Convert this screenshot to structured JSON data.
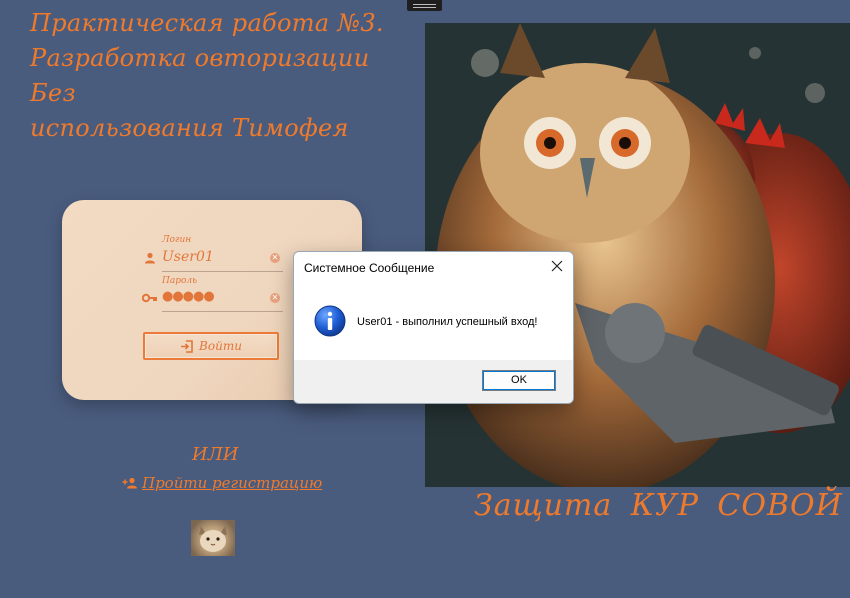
{
  "page": {
    "title_lines": [
      "Практическая работа №3.",
      "Разработка овторизации Без",
      "использования Тимофея"
    ],
    "accent_color": "#f07a2c",
    "background_color": "#4a5c7e"
  },
  "login": {
    "login_label": "Логин",
    "login_value": "User01",
    "password_label": "Пароль",
    "password_value": "●●●●●",
    "login_button": "Войти"
  },
  "alt": {
    "or_text": "ИЛИ",
    "register_link": "Пройти регистрацию"
  },
  "poster": {
    "caption": "Защита КУР СОВОЙ"
  },
  "dialog": {
    "title": "Системное Сообщение",
    "message": "User01 - выполнил успешный вход!",
    "ok_label": "OK"
  },
  "icons": {
    "user": "user-icon",
    "key": "key-icon",
    "clear": "clear-icon",
    "signin": "sign-in-icon",
    "add_user": "add-user-icon",
    "info": "info-icon",
    "close": "close-icon"
  }
}
